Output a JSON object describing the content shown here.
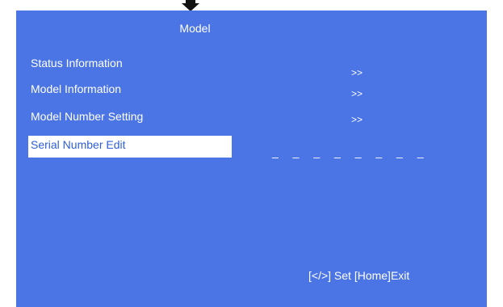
{
  "title": "Model",
  "menu": [
    {
      "label": "Status Information",
      "value": ">>"
    },
    {
      "label": "Model Information",
      "value": ">>"
    },
    {
      "label": "Model Number Setting",
      "value": ">>"
    },
    {
      "label": "Serial Number Edit",
      "value": "_ _ _ _ _ _ _ _"
    }
  ],
  "selected_index": 3,
  "hint": "[</>] Set [Home]Exit",
  "colors": {
    "background": "#4b75e4",
    "text": "#ffffff",
    "selected_background": "#ffffff",
    "selected_text": "#2f5fd6"
  },
  "icons": {
    "top_arrow": "down-arrow-icon"
  }
}
